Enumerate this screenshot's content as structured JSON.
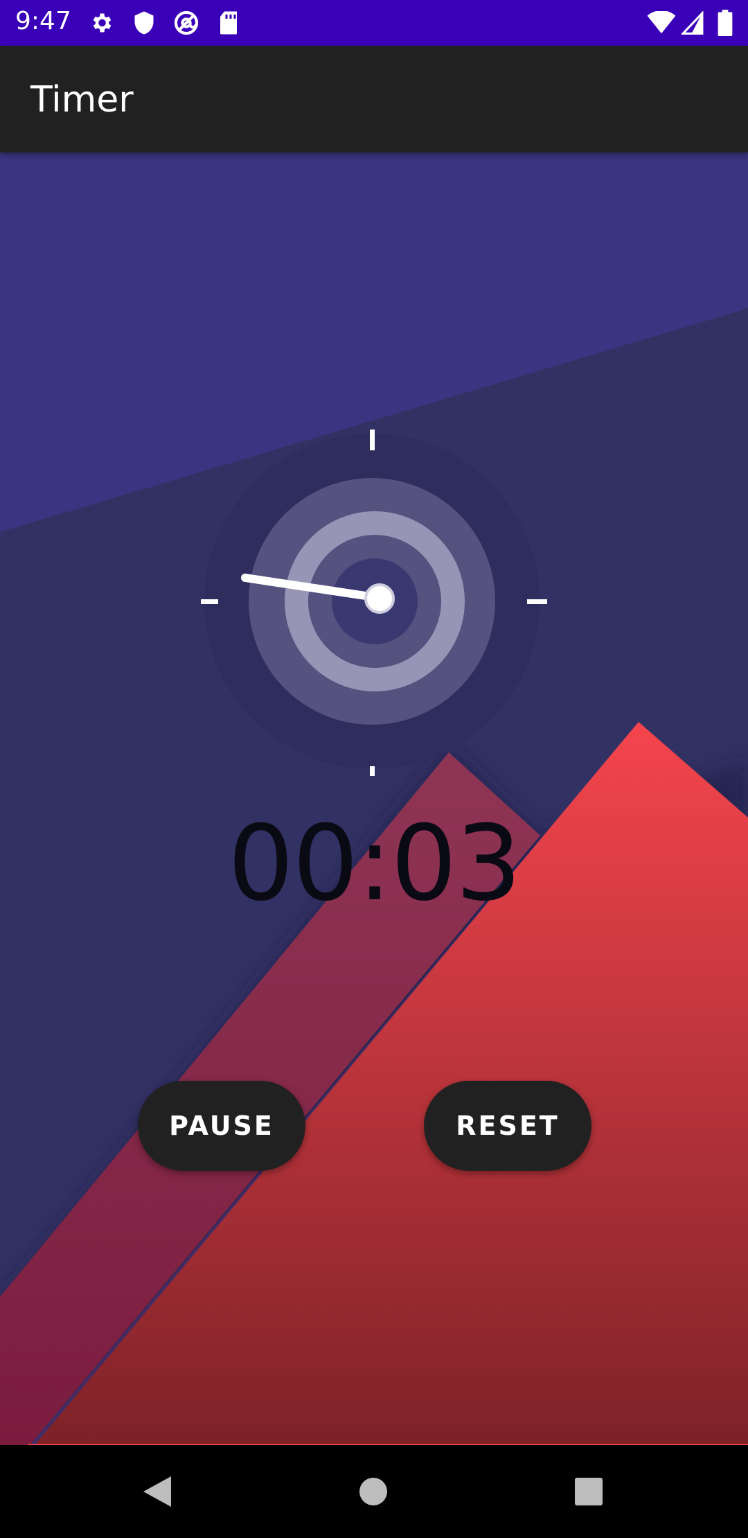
{
  "status_bar": {
    "time": "9:47",
    "left_icons": [
      "gear-icon",
      "shield-icon",
      "at-sign-icon",
      "sd-card-icon"
    ],
    "right_icons": [
      "wifi-icon",
      "signal-icon",
      "battery-icon"
    ],
    "background": "#3a00b8"
  },
  "app_bar": {
    "title": "Timer",
    "background": "#212121"
  },
  "timer": {
    "display": "00:03",
    "pause_label": "PAUSE",
    "reset_label": "RESET"
  },
  "nav_bar": {
    "buttons": [
      "back-icon",
      "home-icon",
      "recents-icon"
    ]
  },
  "colors": {
    "sky_top": "#3a3580",
    "sky_low": "#323163",
    "mountain_red": "#f5454d",
    "mountain_dark": "#7d2228",
    "back_mountain": "#893451",
    "button": "#212121"
  }
}
